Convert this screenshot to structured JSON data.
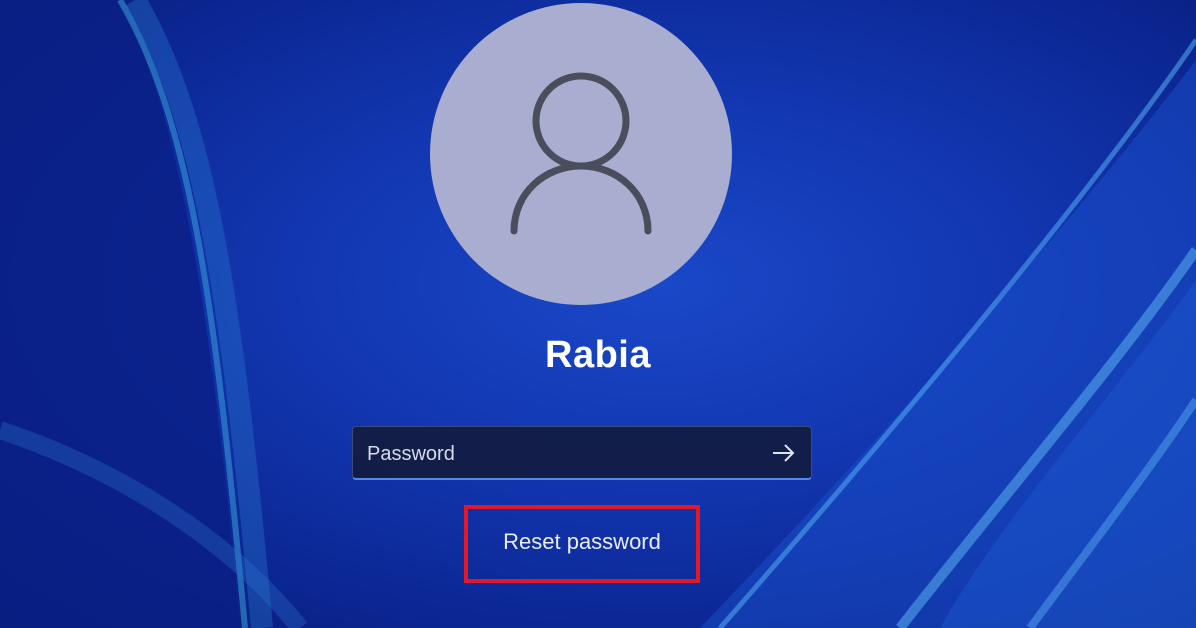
{
  "login": {
    "username": "Rabia",
    "password_placeholder": "Password",
    "password_value": "",
    "reset_password_label": "Reset password"
  },
  "icons": {
    "avatar": "user-silhouette-icon",
    "submit": "arrow-right-icon"
  },
  "colors": {
    "background": "#1236b0",
    "avatar_circle": "#a9aed0",
    "input_accent": "#4d8de8",
    "highlight_box": "#e0182a"
  }
}
